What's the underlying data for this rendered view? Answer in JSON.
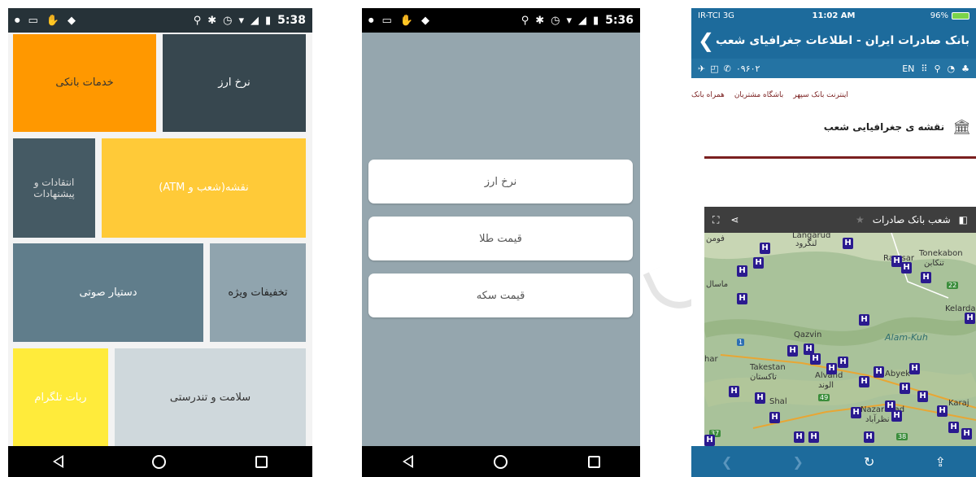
{
  "phone1": {
    "status_time": "5:38",
    "tiles": [
      {
        "label": "نرخ ارز",
        "color": "#37474f"
      },
      {
        "label": "خدمات بانکی",
        "color": "#ff9800"
      },
      {
        "label": "نقشه(شعب و ATM)",
        "color": "#ffca38"
      },
      {
        "label": "انتقادات و پیشنهادات",
        "color": "#455a64"
      },
      {
        "label": "تخفیفات ویژه",
        "color": "#90a4ae"
      },
      {
        "label": "دستیار صوتی",
        "color": "#607d8b"
      },
      {
        "label": "سلامت و تندرستی",
        "color": "#cfd8dc"
      },
      {
        "label": "ربات تلگرام",
        "color": "#ffeb3b"
      }
    ]
  },
  "phone2": {
    "status_time": "5:36",
    "buttons": [
      {
        "label": "نرخ ارز"
      },
      {
        "label": "قیمت طلا"
      },
      {
        "label": "قیمت سکه"
      }
    ]
  },
  "phone3": {
    "carrier": "IR-TCI  3G",
    "time": "11:02 AM",
    "battery": "96%",
    "title": "بانک صادرات ایران - اطلاعات جغرافیای شعب",
    "phone_number": "۰۹۶۰۲",
    "lang": "EN",
    "menu": [
      {
        "label": "اینترنت بانک سپهر"
      },
      {
        "label": "باشگاه مشتریان"
      },
      {
        "label": "همراه بانک"
      }
    ],
    "geo_header": "نقشه ی جغرافیایی شعب",
    "map_title": "شعب بانک صادرات",
    "map_labels": {
      "langarud": "Langarud",
      "langarud_fa": "لنگرود",
      "ramsar": "Ramsar",
      "tonekabon": "Tonekabon",
      "tonekabon_fa": "تنکابن",
      "qazvin": "Qazvin",
      "alamkuh": "Alam-Kuh",
      "takestan": "Takestan",
      "takestan_fa": "تاکستان",
      "abyek": "Abyek",
      "alvand": "Alvand",
      "alvand_fa": "الوند",
      "shal": "Shal",
      "nazarabad": "Nazarabad",
      "nazarabad_fa": "نظرآباد",
      "karaj": "Karaj",
      "kelardasht": "Kelardasht",
      "fumen": "فومن",
      "abhar": "har",
      "masal": "ماسال",
      "road_22": "22",
      "road_49": "49",
      "road_37": "37",
      "road_38": "38",
      "road_1": "1"
    }
  }
}
